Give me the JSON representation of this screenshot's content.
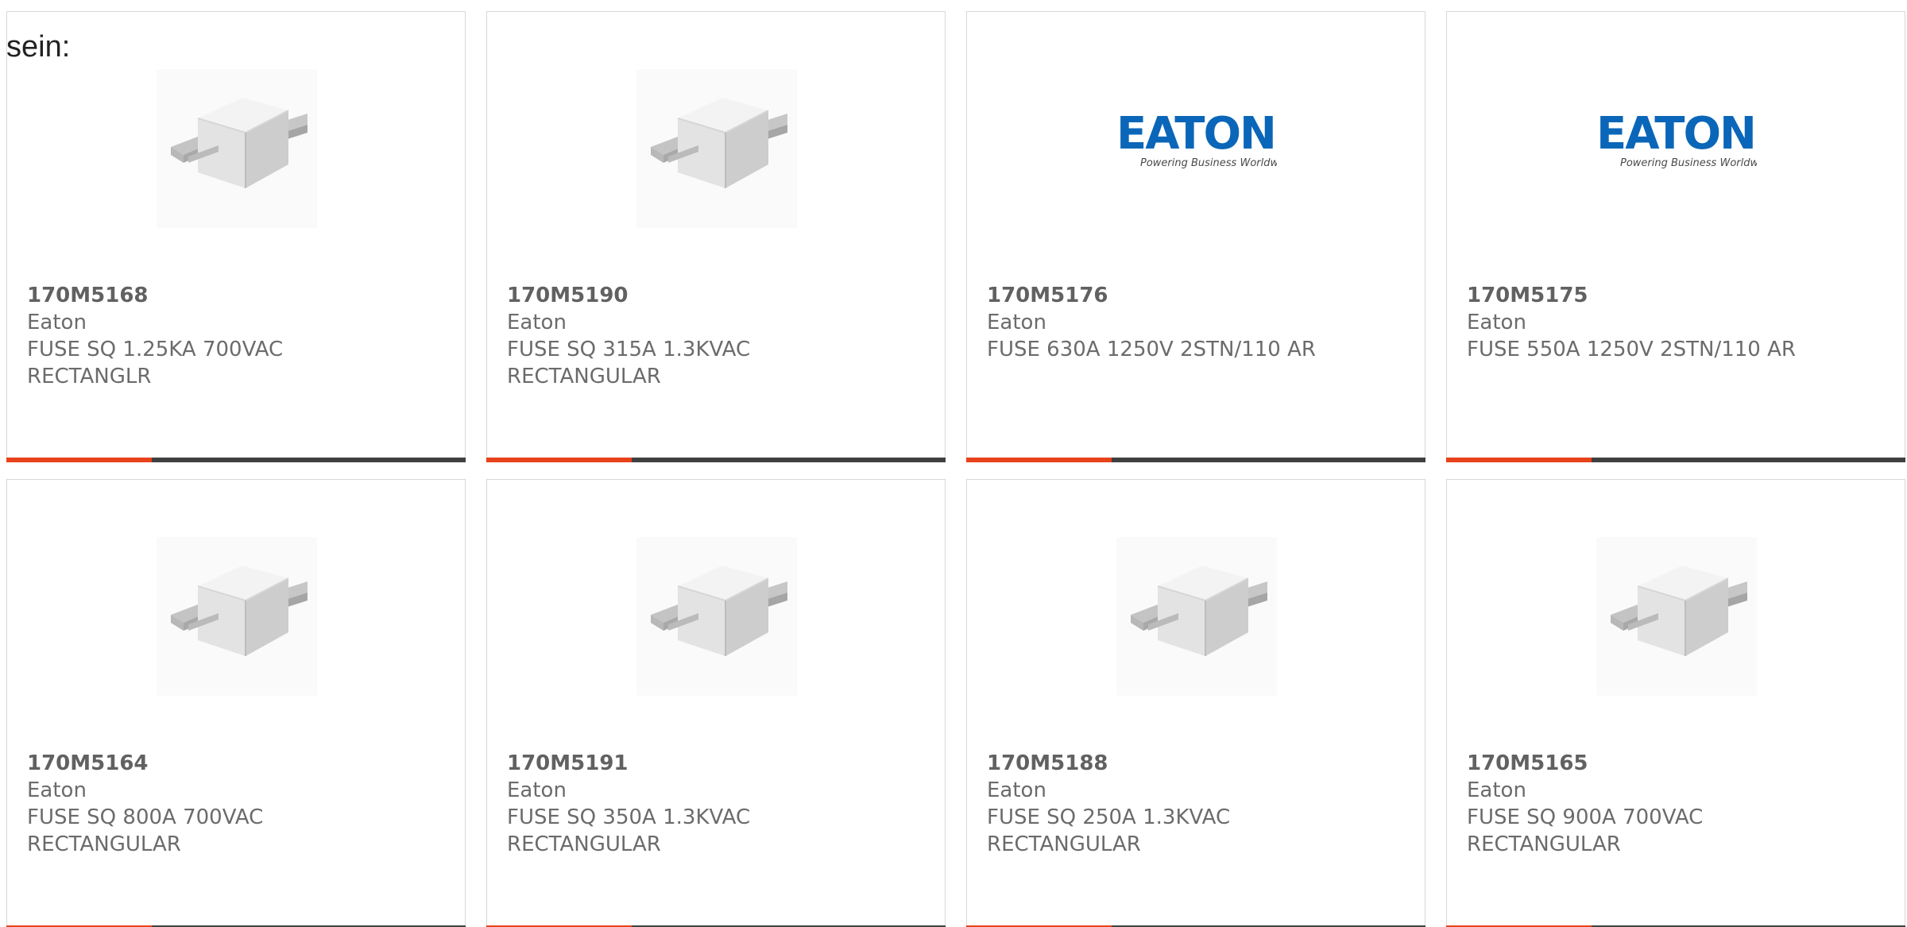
{
  "intro_text": "sein:",
  "colors": {
    "accent_bar": "#e8421b",
    "dark_bar": "#404040",
    "brand_blue": "#0a66b8"
  },
  "cards": [
    {
      "part": "170M5168",
      "brand": "Eaton",
      "desc_line1": "FUSE SQ 1.25KA 700VAC",
      "desc_line2": "RECTANGLR",
      "image": "fuse-icon"
    },
    {
      "part": "170M5190",
      "brand": "Eaton",
      "desc_line1": "FUSE SQ 315A 1.3KVAC",
      "desc_line2": "RECTANGULAR",
      "image": "fuse-icon"
    },
    {
      "part": "170M5176",
      "brand": "Eaton",
      "desc_line1": "FUSE 630A 1250V 2STN/110 AR",
      "desc_line2": "",
      "image": "eaton-logo",
      "logo_word": "EATON",
      "logo_tagline": "Powering Business Worldwide"
    },
    {
      "part": "170M5175",
      "brand": "Eaton",
      "desc_line1": "FUSE 550A 1250V 2STN/110 AR",
      "desc_line2": "",
      "image": "eaton-logo",
      "logo_word": "EATON",
      "logo_tagline": "Powering Business Worldwide"
    },
    {
      "part": "170M5164",
      "brand": "Eaton",
      "desc_line1": "FUSE SQ 800A 700VAC",
      "desc_line2": "RECTANGULAR",
      "image": "fuse-icon"
    },
    {
      "part": "170M5191",
      "brand": "Eaton",
      "desc_line1": "FUSE SQ 350A 1.3KVAC",
      "desc_line2": "RECTANGULAR",
      "image": "fuse-icon"
    },
    {
      "part": "170M5188",
      "brand": "Eaton",
      "desc_line1": "FUSE SQ 250A 1.3KVAC",
      "desc_line2": "RECTANGULAR",
      "image": "fuse-icon"
    },
    {
      "part": "170M5165",
      "brand": "Eaton",
      "desc_line1": "FUSE SQ 900A 700VAC",
      "desc_line2": "RECTANGULAR",
      "image": "fuse-icon"
    }
  ]
}
